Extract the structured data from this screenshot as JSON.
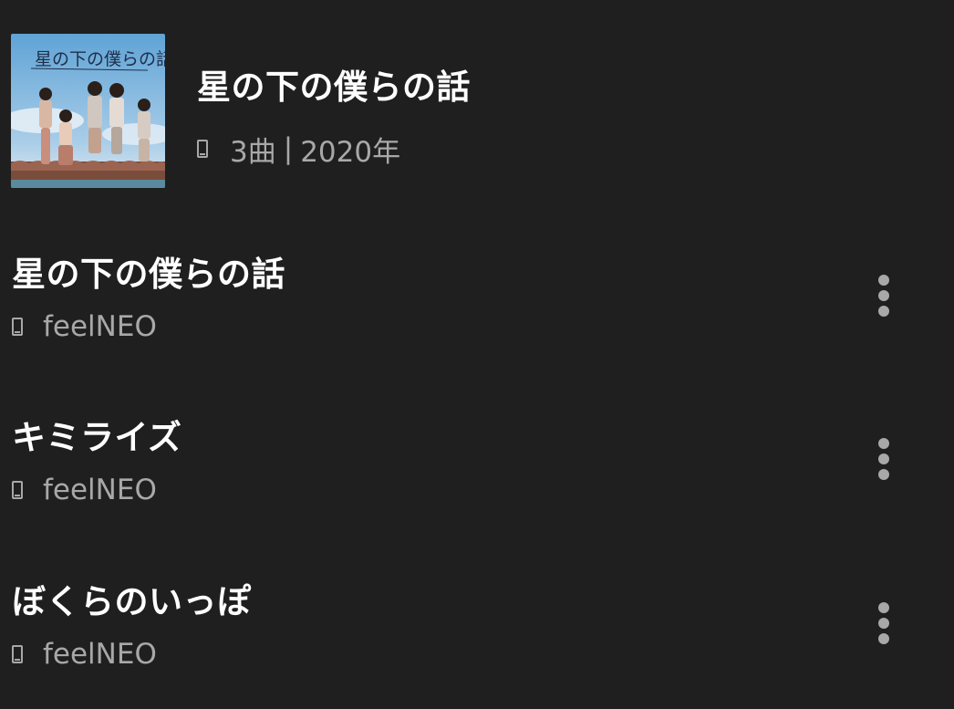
{
  "album": {
    "title": "星の下の僕らの話",
    "track_count": "3曲",
    "separator": "|",
    "year": "2020年",
    "cover_text": "星の下の僕らの話",
    "meta_icon": "device-icon"
  },
  "tracks": [
    {
      "title": "星の下の僕らの話",
      "artist": "feelNEO",
      "icon": "device-icon",
      "menu_icon": "more-vert-icon"
    },
    {
      "title": "キミライズ",
      "artist": "feelNEO",
      "icon": "device-icon",
      "menu_icon": "more-vert-icon"
    },
    {
      "title": "ぼくらのいっぽ",
      "artist": "feelNEO",
      "icon": "device-icon",
      "menu_icon": "more-vert-icon"
    }
  ],
  "colors": {
    "background": "#1f1f1f",
    "primary_text": "#ffffff",
    "secondary_text": "#a8a8a8"
  }
}
